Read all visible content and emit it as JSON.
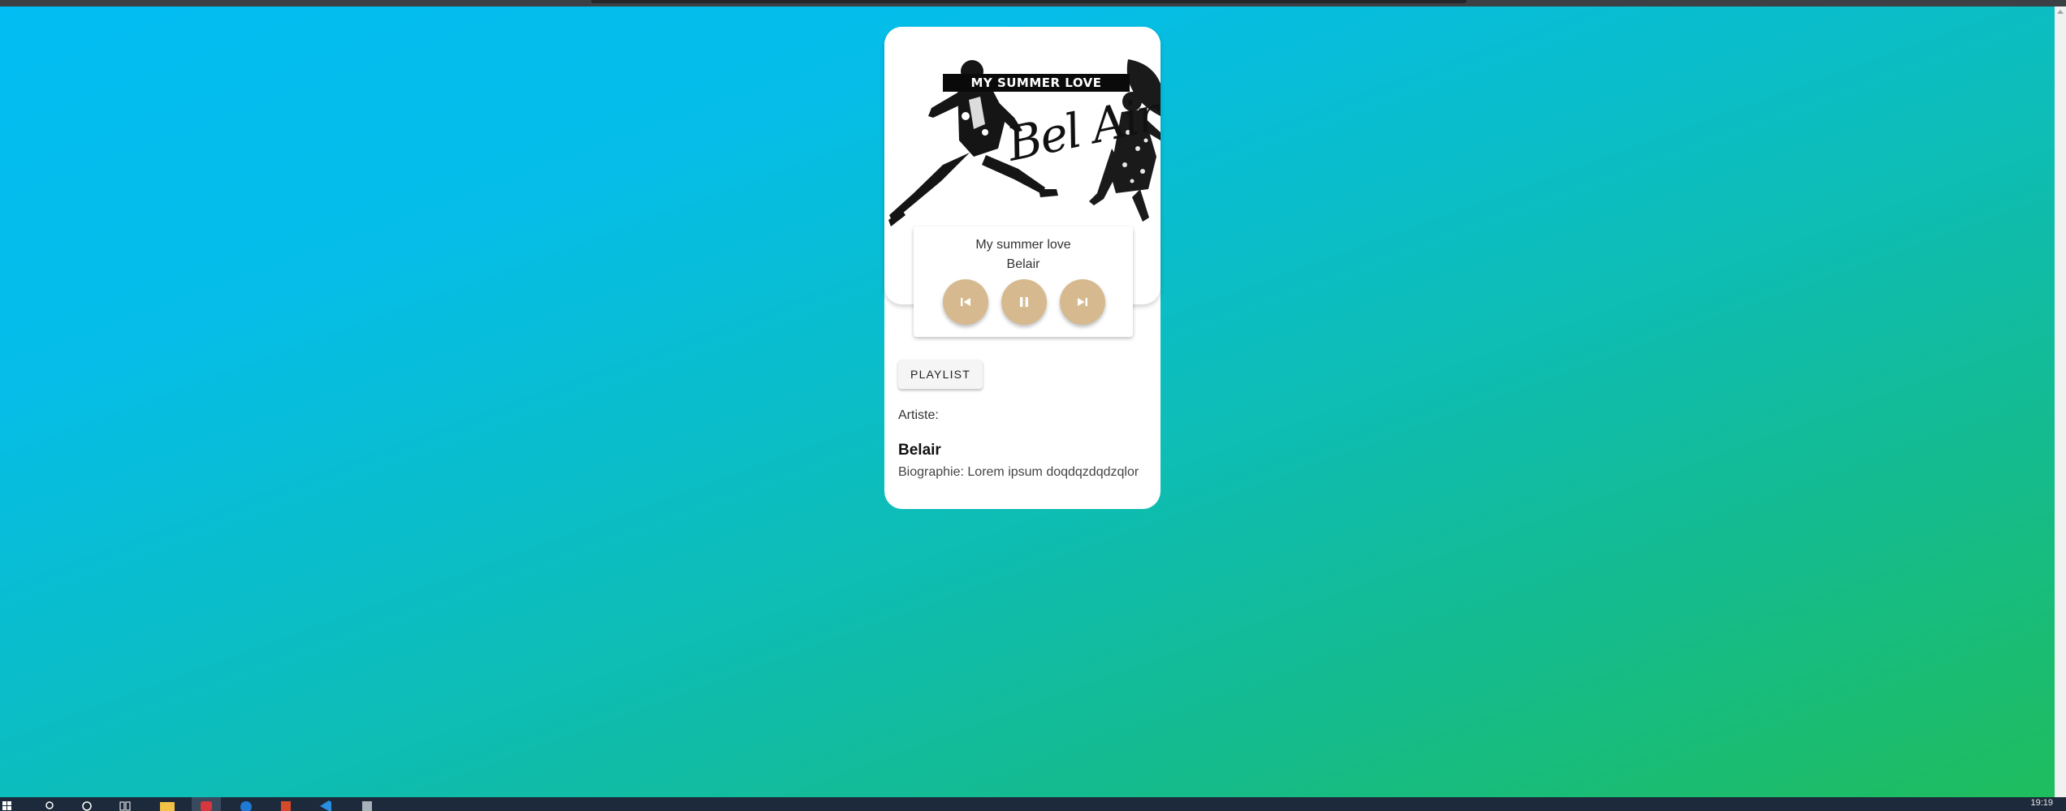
{
  "player": {
    "cover_title": "MY SUMMER LOVE",
    "cover_script": "Bel Air",
    "track_title": "My summer love",
    "track_artist": "Belair",
    "controls": [
      "skip-previous-icon",
      "pause-icon",
      "skip-next-icon"
    ]
  },
  "playlist_label": "PLAYLIST",
  "artist_section": {
    "label": "Artiste:",
    "name": "Belair",
    "bio": "Biographie: Lorem ipsum doqdqzdqdzqlor"
  },
  "taskbar": {
    "clock": "19:19",
    "icons": [
      "windows-start-icon",
      "search-icon",
      "cortana-icon",
      "task-view-icon",
      "file-explorer-icon",
      "app-red-icon",
      "edge-icon",
      "office-icon",
      "vscode-icon",
      "app-grey-icon"
    ]
  },
  "colors": {
    "gradient_start": "#02bdf3",
    "gradient_end": "#1fbd5b",
    "control_button": "#d6b98e",
    "card": "#ffffff",
    "taskbar": "#1d2a3b"
  }
}
